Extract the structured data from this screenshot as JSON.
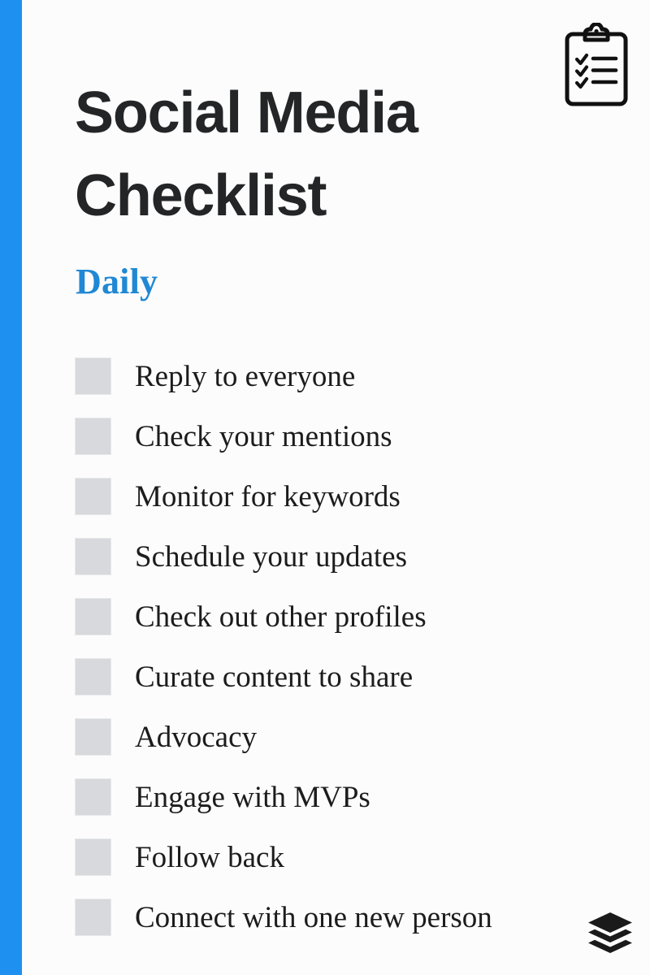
{
  "page": {
    "background_color": "#fcfcfd",
    "accent_color": "#1e90f0"
  },
  "header": {
    "title": "Social Media\nChecklist",
    "clipboard_icon": "clipboard-checklist-icon"
  },
  "section": {
    "heading": "Daily",
    "heading_color": "#2088d4"
  },
  "checklist": {
    "checkbox_color": "#d7d9dc",
    "items": [
      {
        "label": "Reply to everyone",
        "checked": false
      },
      {
        "label": "Check your mentions",
        "checked": false
      },
      {
        "label": "Monitor for keywords",
        "checked": false
      },
      {
        "label": "Schedule your updates",
        "checked": false
      },
      {
        "label": "Check out other profiles",
        "checked": false
      },
      {
        "label": "Curate content to share",
        "checked": false
      },
      {
        "label": "Advocacy",
        "checked": false
      },
      {
        "label": "Engage with MVPs",
        "checked": false
      },
      {
        "label": "Follow back",
        "checked": false
      },
      {
        "label": "Connect with one new person",
        "checked": false
      }
    ]
  },
  "footer": {
    "logo_icon": "stacked-layers-logo-icon",
    "logo_color": "#1a1a1a"
  }
}
